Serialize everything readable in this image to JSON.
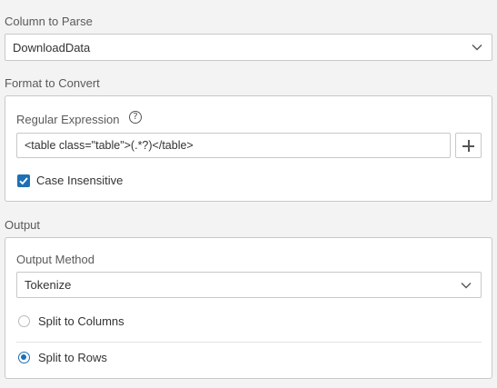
{
  "column_to_parse": {
    "title": "Column to Parse",
    "selected": "DownloadData",
    "icon": "chevron-down-icon"
  },
  "format_to_convert": {
    "title": "Format to Convert",
    "regex_label": "Regular Expression",
    "help_icon": "help-icon",
    "help_glyph": "?",
    "regex_value": "<table class=\"table\">(.*?)</table>",
    "add_icon": "plus-icon",
    "case_insensitive": {
      "label": "Case Insensitive",
      "checked": true
    }
  },
  "output": {
    "title": "Output",
    "method_label": "Output Method",
    "method_selected": "Tokenize",
    "options": [
      {
        "label": "Split to Columns",
        "selected": false
      },
      {
        "label": "Split to Rows",
        "selected": true
      }
    ]
  },
  "colors": {
    "accent": "#1f6fb5",
    "background": "#f3f3f3",
    "border": "#c8c8c8"
  }
}
